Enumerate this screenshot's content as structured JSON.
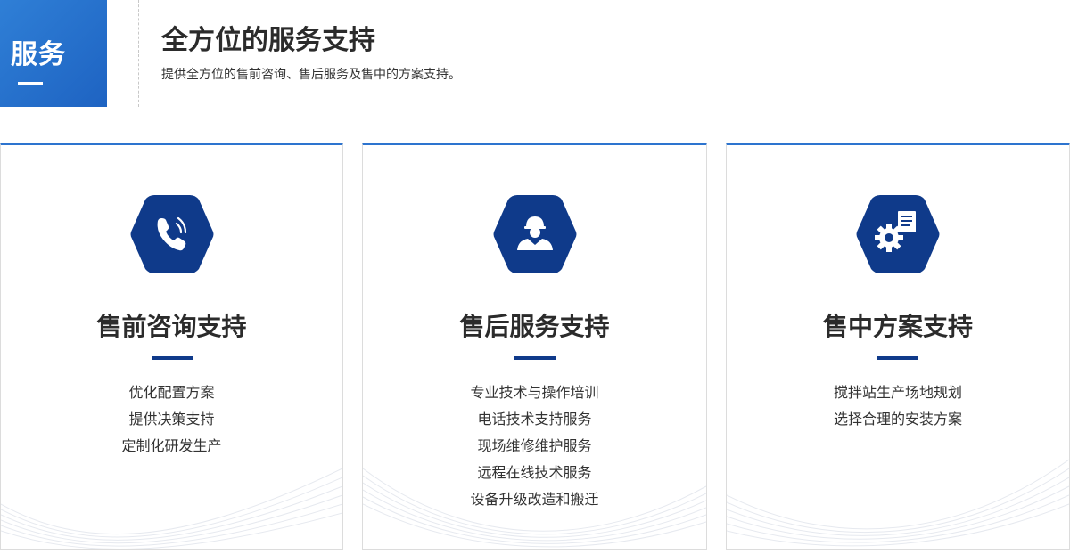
{
  "badge": {
    "label": "服务"
  },
  "header": {
    "title": "全方位的服务支持",
    "subtitle": "提供全方位的售前咨询、售后服务及售中的方案支持。"
  },
  "cards": [
    {
      "icon": "phone-icon",
      "title": "售前咨询支持",
      "items": [
        "优化配置方案",
        "提供决策支持",
        "定制化研发生产"
      ]
    },
    {
      "icon": "engineer-icon",
      "title": "售后服务支持",
      "items": [
        "专业技术与操作培训",
        "电话技术支持服务",
        "现场维修维护服务",
        "远程在线技术服务",
        "设备升级改造和搬迁"
      ]
    },
    {
      "icon": "gear-document-icon",
      "title": "售中方案支持",
      "items": [
        "搅拌站生产场地规划",
        "选择合理的安装方案"
      ]
    }
  ],
  "colors": {
    "badge_blue": "#2f7fd6",
    "card_top_border": "#2d74cf",
    "hex_navy": "#0f3a8a",
    "title_text": "#2b2b2b"
  }
}
